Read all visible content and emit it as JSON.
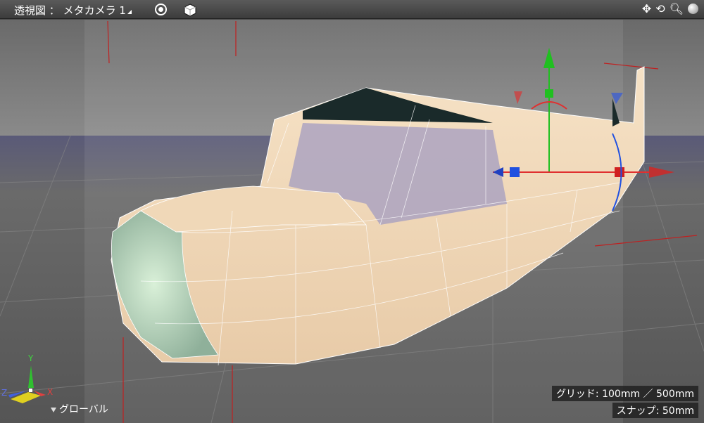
{
  "header": {
    "view_name": "透視図",
    "separator": "：",
    "camera": "メタカメラ 1"
  },
  "toolbar_icons": [
    "target-icon",
    "cube-icon",
    "move-icon",
    "rotate-icon",
    "zoom-icon",
    "sphere-icon"
  ],
  "hud": {
    "grid": "グリッド: 100mm ／ 500mm",
    "snap": "スナップ: 50mm",
    "coordinate_mode": "グローバル"
  },
  "axes": {
    "x": "X",
    "y": "Y",
    "z": "Z"
  },
  "colors": {
    "x_axis": "#e03030",
    "y_axis": "#20c020",
    "z_axis": "#3050e0",
    "model": "#f2dcc0"
  }
}
